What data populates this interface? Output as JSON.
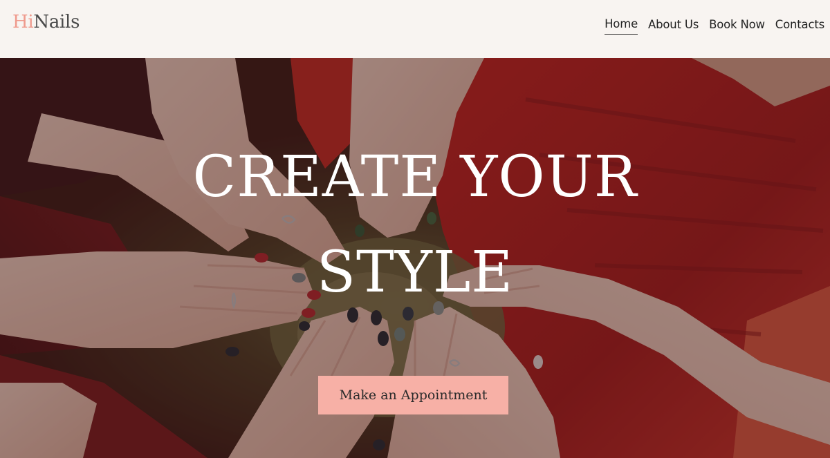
{
  "brand": {
    "prefix": "Hi",
    "suffix": "Nails",
    "accent_color": "#ef9a8d"
  },
  "nav": {
    "items": [
      {
        "label": "Home",
        "active": true
      },
      {
        "label": "About Us",
        "active": false
      },
      {
        "label": "Book Now",
        "active": false
      },
      {
        "label": "Contacts",
        "active": false
      }
    ]
  },
  "hero": {
    "title_line1": "CREATE YOUR",
    "title_line2": "STYLE",
    "cta_label": "Make an Appointment",
    "cta_color": "#f7b0a6",
    "photo": "hands-with-painted-nails-circle"
  },
  "colors": {
    "header_bg": "#f8f4f1",
    "overlay_tint": "#301216"
  }
}
